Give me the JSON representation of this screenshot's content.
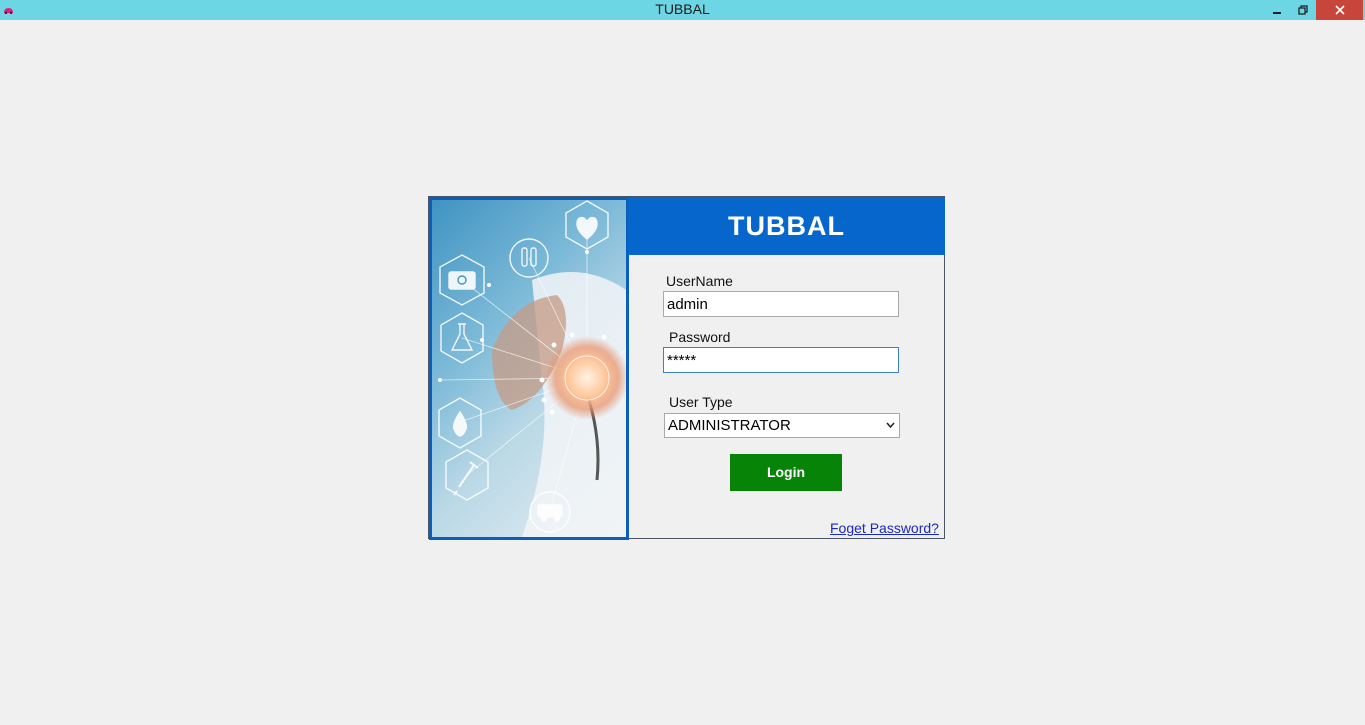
{
  "window": {
    "title": "TUBBAL"
  },
  "colors": {
    "titlebar": "#6dd6e4",
    "header": "#0766cc",
    "login_button": "#078407",
    "close_button": "#c7453b",
    "link": "#1a28c9"
  },
  "icons": {
    "app": "app-icon",
    "minimize": "minimize-icon",
    "maximize": "restore-icon",
    "close": "close-icon",
    "dropdown": "chevron-down-icon",
    "photo_icons": [
      "heart-monitor-icon",
      "test-tubes-icon",
      "first-aid-kit-icon",
      "flask-icon",
      "drop-icon",
      "syringe-icon",
      "ambulance-icon"
    ]
  },
  "login": {
    "header_title": "TUBBAL",
    "username_label": "UserName",
    "username_value": "admin",
    "password_label": "Password",
    "password_value": "*****",
    "user_type_label": "User Type",
    "user_type_value": "ADMINISTRATOR",
    "login_label": "Login",
    "forgot_label": "Foget Password?"
  }
}
